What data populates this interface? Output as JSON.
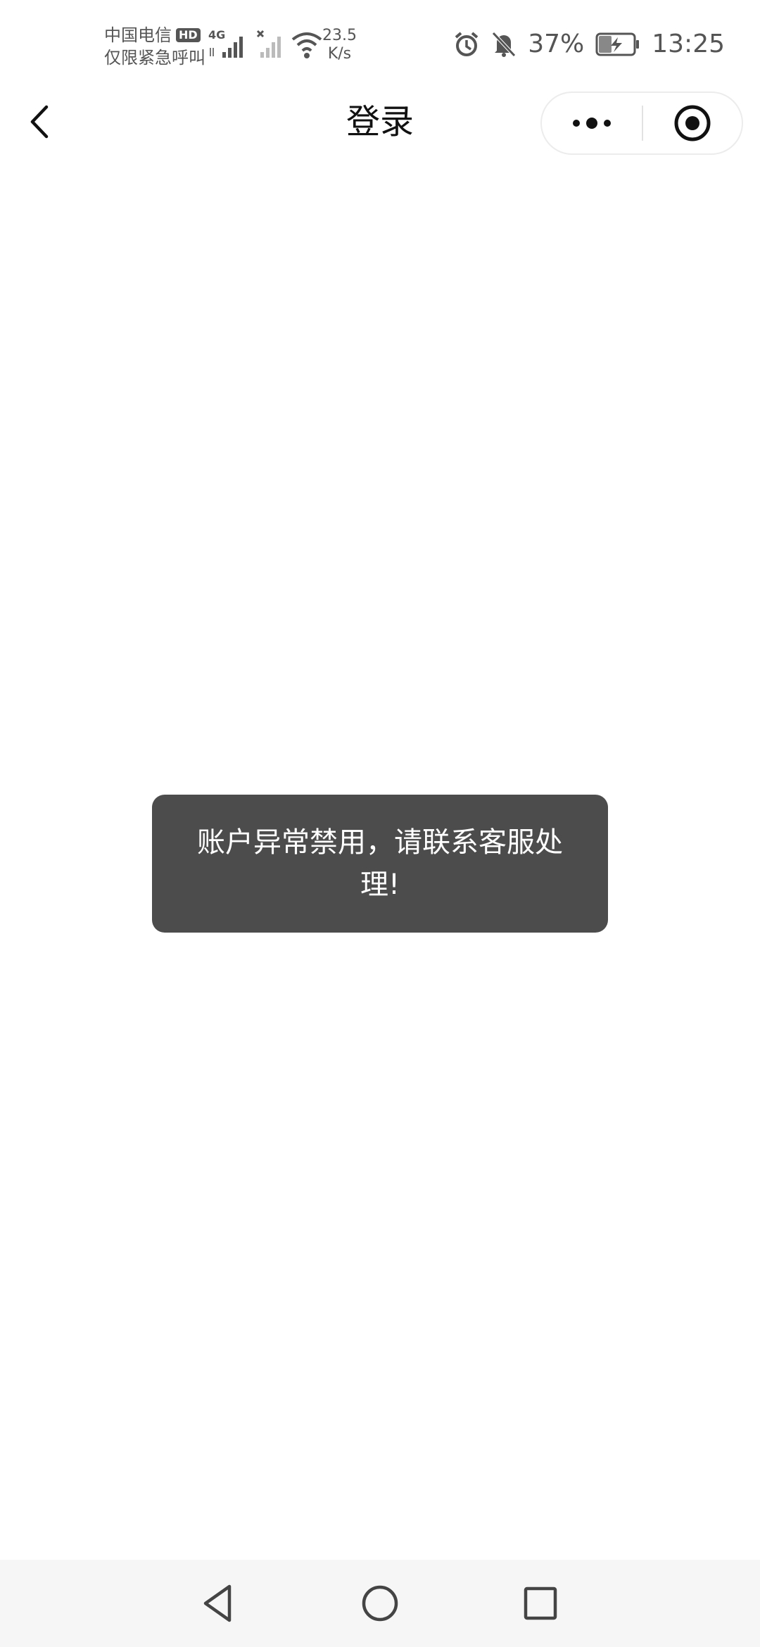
{
  "status_bar": {
    "carrier_name": "中国电信",
    "carrier_badge": "HD",
    "emergency_text": "仅限紧急呼叫",
    "network_type": "4G",
    "net_speed_value": "23.5",
    "net_speed_unit": "K/s",
    "battery_percent": "37%",
    "time": "13:25",
    "icons": [
      "signal-4g-icon",
      "no-sim-signal-icon",
      "wifi-icon",
      "alarm-icon",
      "mute-bell-icon",
      "battery-charging-icon"
    ]
  },
  "nav": {
    "title": "登录",
    "icons": [
      "back-arrow-icon",
      "more-dots-icon",
      "close-target-icon"
    ]
  },
  "toast": {
    "message": "账户异常禁用，请联系客服处理!"
  },
  "system_nav": {
    "icons": [
      "triangle-back-icon",
      "circle-home-icon",
      "square-recents-icon"
    ]
  }
}
